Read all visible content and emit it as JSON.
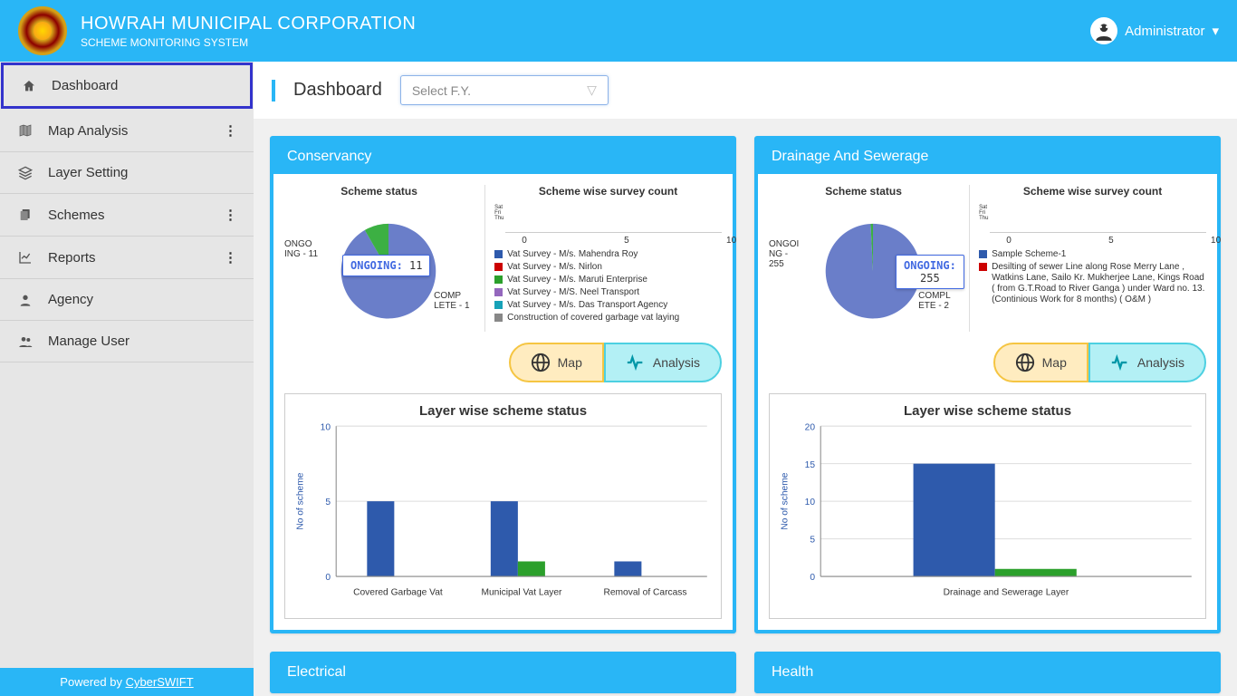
{
  "header": {
    "org": "HOWRAH MUNICIPAL CORPORATION",
    "subtitle": "SCHEME MONITORING SYSTEM",
    "user_label": "Administrator"
  },
  "sidebar": {
    "items": [
      {
        "label": "Dashboard",
        "icon": "home",
        "more": false
      },
      {
        "label": "Map Analysis",
        "icon": "map",
        "more": true
      },
      {
        "label": "Layer Setting",
        "icon": "layers",
        "more": false
      },
      {
        "label": "Schemes",
        "icon": "copy",
        "more": true
      },
      {
        "label": "Reports",
        "icon": "chart",
        "more": true
      },
      {
        "label": "Agency",
        "icon": "user",
        "more": false
      },
      {
        "label": "Manage User",
        "icon": "users",
        "more": false
      }
    ],
    "footer_prefix": "Powered by ",
    "footer_link": "CyberSWIFT"
  },
  "page": {
    "title": "Dashboard",
    "fy_placeholder": "Select F.Y."
  },
  "buttons": {
    "map": "Map",
    "analysis": "Analysis"
  },
  "panels": [
    {
      "title": "Conservancy",
      "pie_title": "Scheme status",
      "list_title": "Scheme wise survey count",
      "tooltip": {
        "label": "ONGOING:",
        "value": "11"
      },
      "pie_labels": {
        "left": "ONGO ING - 11",
        "right": "COMP LETE - 1"
      },
      "axis": {
        "ticks": [
          "0",
          "5",
          "10"
        ]
      },
      "legend": [
        {
          "color": "#2e5aac",
          "text": "Vat Survey - M/s. Mahendra Roy"
        },
        {
          "color": "#cc0000",
          "text": "Vat Survey - M/s. Nirlon"
        },
        {
          "color": "#2ca02c",
          "text": "Vat Survey - M/s. Maruti Enterprise"
        },
        {
          "color": "#9467bd",
          "text": "Vat Survey - M/S. Neel Transport"
        },
        {
          "color": "#17a2b8",
          "text": "Vat Survey - M/s. Das Transport Agency"
        },
        {
          "color": "#888888",
          "text": "Construction of covered garbage vat laying"
        }
      ],
      "bar_title": "Layer wise scheme status",
      "bar_ylabel": "No of scheme",
      "chart_data": {
        "pie": {
          "type": "pie",
          "slices": [
            {
              "name": "ONGOING",
              "value": 11
            },
            {
              "name": "COMPLETE",
              "value": 1
            }
          ]
        },
        "bar": {
          "type": "bar",
          "categories": [
            "Covered Garbage Vat",
            "Municipal Vat Layer",
            "Removal of Carcass"
          ],
          "series": [
            {
              "name": "ongoing",
              "color": "#2e5aac",
              "values": [
                5,
                5,
                1
              ]
            },
            {
              "name": "complete",
              "color": "#2ca02c",
              "values": [
                0,
                1,
                0
              ]
            }
          ],
          "ylim": [
            0,
            10
          ],
          "yticks": [
            0,
            5,
            10
          ]
        }
      }
    },
    {
      "title": "Drainage And Sewerage",
      "pie_title": "Scheme status",
      "list_title": "Scheme wise survey count",
      "tooltip": {
        "label": "ONGOING:",
        "value": "255"
      },
      "pie_labels": {
        "left": "ONGOI NG - 255",
        "right": "COMPL ETE - 2"
      },
      "axis": {
        "ticks": [
          "0",
          "5",
          "10"
        ]
      },
      "legend": [
        {
          "color": "#2e5aac",
          "text": "Sample Scheme-1"
        },
        {
          "color": "#cc0000",
          "text": "Desilting of sewer Line along Rose Merry Lane , Watkins Lane, Sailo Kr. Mukherjee Lane, Kings Road ( from G.T.Road to River Ganga ) under Ward no. 13. (Continious Work for 8 months)  ( O&M )"
        }
      ],
      "bar_title": "Layer wise scheme status",
      "bar_ylabel": "No of scheme",
      "chart_data": {
        "pie": {
          "type": "pie",
          "slices": [
            {
              "name": "ONGOING",
              "value": 255
            },
            {
              "name": "COMPLETE",
              "value": 2
            }
          ]
        },
        "bar": {
          "type": "bar",
          "categories": [
            "Drainage and Sewerage Layer"
          ],
          "series": [
            {
              "name": "ongoing",
              "color": "#2e5aac",
              "values": [
                15
              ]
            },
            {
              "name": "complete",
              "color": "#2ca02c",
              "values": [
                1
              ]
            }
          ],
          "ylim": [
            0,
            20
          ],
          "yticks": [
            0,
            5,
            10,
            15,
            20
          ]
        }
      }
    },
    {
      "title": "Electrical"
    },
    {
      "title": "Health"
    }
  ]
}
